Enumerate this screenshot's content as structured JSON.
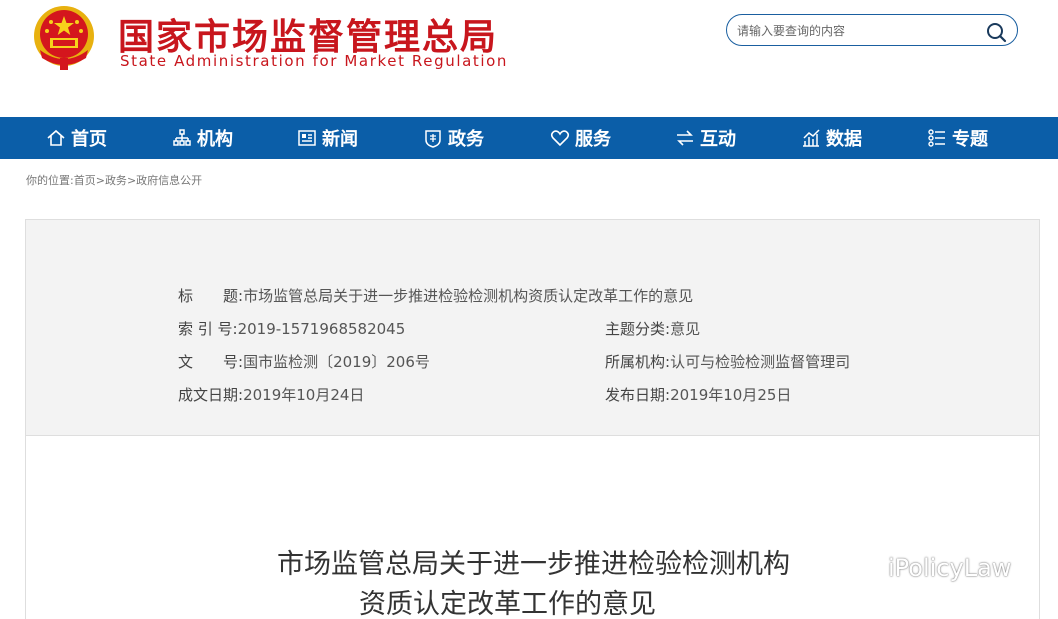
{
  "header": {
    "title": "国家市场监督管理总局",
    "subtitle": "State Administration for Market Regulation",
    "search_placeholder": "请输入要查询的内容"
  },
  "nav": {
    "items": [
      {
        "label": "首页",
        "icon": "home-icon"
      },
      {
        "label": "机构",
        "icon": "org-icon"
      },
      {
        "label": "新闻",
        "icon": "news-icon"
      },
      {
        "label": "政务",
        "icon": "affairs-icon"
      },
      {
        "label": "服务",
        "icon": "heart-icon"
      },
      {
        "label": "互动",
        "icon": "exchange-icon"
      },
      {
        "label": "数据",
        "icon": "chart-icon"
      },
      {
        "label": "专题",
        "icon": "topic-icon"
      }
    ]
  },
  "breadcrumb": {
    "prefix": "你的位置:",
    "items": [
      "首页",
      "政务",
      "政府信息公开"
    ],
    "separator": ">"
  },
  "info": {
    "title_label": "标　　题:",
    "title_value": "市场监管总局关于进一步推进检验检测机构资质认定改革工作的意见",
    "index_label": "索 引 号:",
    "index_value": "2019-1571968582045",
    "topic_label": "主题分类:",
    "topic_value": "意见",
    "doc_label": "文　　号:",
    "doc_value": "国市监检测〔2019〕206号",
    "org_label": "所属机构:",
    "org_value": "认可与检验检测监督管理司",
    "date_label": "成文日期:",
    "date_value": "2019年10月24日",
    "publish_label": "发布日期:",
    "publish_value": "2019年10月25日"
  },
  "article": {
    "title_line1": "市场监管总局关于进一步推进检验检测机构",
    "title_line2": "资质认定改革工作的意见"
  },
  "watermark": {
    "text": "iPolicyLaw",
    "icon": "wechat-icon"
  },
  "colors": {
    "brand_red": "#c8161d",
    "nav_blue": "#0b5ea8",
    "panel_gray": "#f3f3f3"
  }
}
